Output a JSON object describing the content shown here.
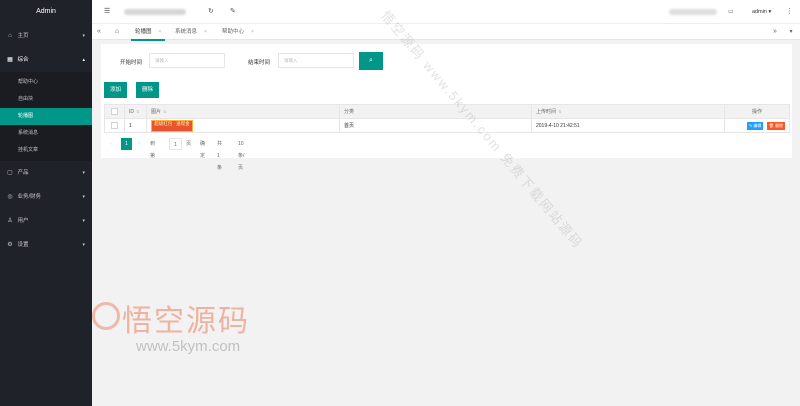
{
  "app": {
    "title": "Admin"
  },
  "sidebar": {
    "items": [
      {
        "icon": "home-icon",
        "glyph": "⌂",
        "label": "主页"
      },
      {
        "icon": "grid-icon",
        "glyph": "▦",
        "label": "综合"
      },
      {
        "icon": "product-icon",
        "glyph": "▢",
        "label": "产品"
      },
      {
        "icon": "finance-icon",
        "glyph": "◎",
        "label": "业务/财务"
      },
      {
        "icon": "user-icon",
        "glyph": "♙",
        "label": "用户"
      },
      {
        "icon": "settings-icon",
        "glyph": "⚙",
        "label": "设置"
      }
    ],
    "sub_items": [
      "帮助中心",
      "自由块",
      "轮播图",
      "系统消息",
      "挂机文章"
    ]
  },
  "header": {
    "user": "admin",
    "user_caret": "▾"
  },
  "tabs": [
    {
      "label": "轮播图",
      "close": "×"
    },
    {
      "label": "系统消息",
      "close": "×"
    },
    {
      "label": "帮助中心",
      "close": "×"
    }
  ],
  "filters": {
    "start_label": "开始时间",
    "start_placeholder": "请输入",
    "end_label": "结束时间",
    "end_placeholder": "请输入"
  },
  "actions": {
    "add": "添加",
    "delete": "删除"
  },
  "table": {
    "columns": [
      "ID",
      "图片",
      "分类",
      "上传时间",
      "操作"
    ],
    "rows": [
      {
        "id": "1",
        "image_text": "超级红包 · 送现金",
        "category": "首页",
        "uploaded": "2019-4-10 21:42:51",
        "edit": "编辑",
        "delete": "删除"
      }
    ]
  },
  "pager": {
    "prev": "‹",
    "current": "1",
    "next": "›",
    "goto_label": "到第",
    "goto_value": "1",
    "page_unit": "页",
    "confirm": "确定",
    "total": "共 1 条",
    "page_size": "10 条/页"
  },
  "watermarks": {
    "diagonal_1": "悟空源码 www.5kym.com 免费下载网站源码",
    "logo_title": "悟空源码",
    "logo_url": "www.5kym.com"
  },
  "colors": {
    "accent": "#009688",
    "sidebar": "#20222a",
    "edit": "#1e9fff",
    "danger": "#ff5722"
  }
}
